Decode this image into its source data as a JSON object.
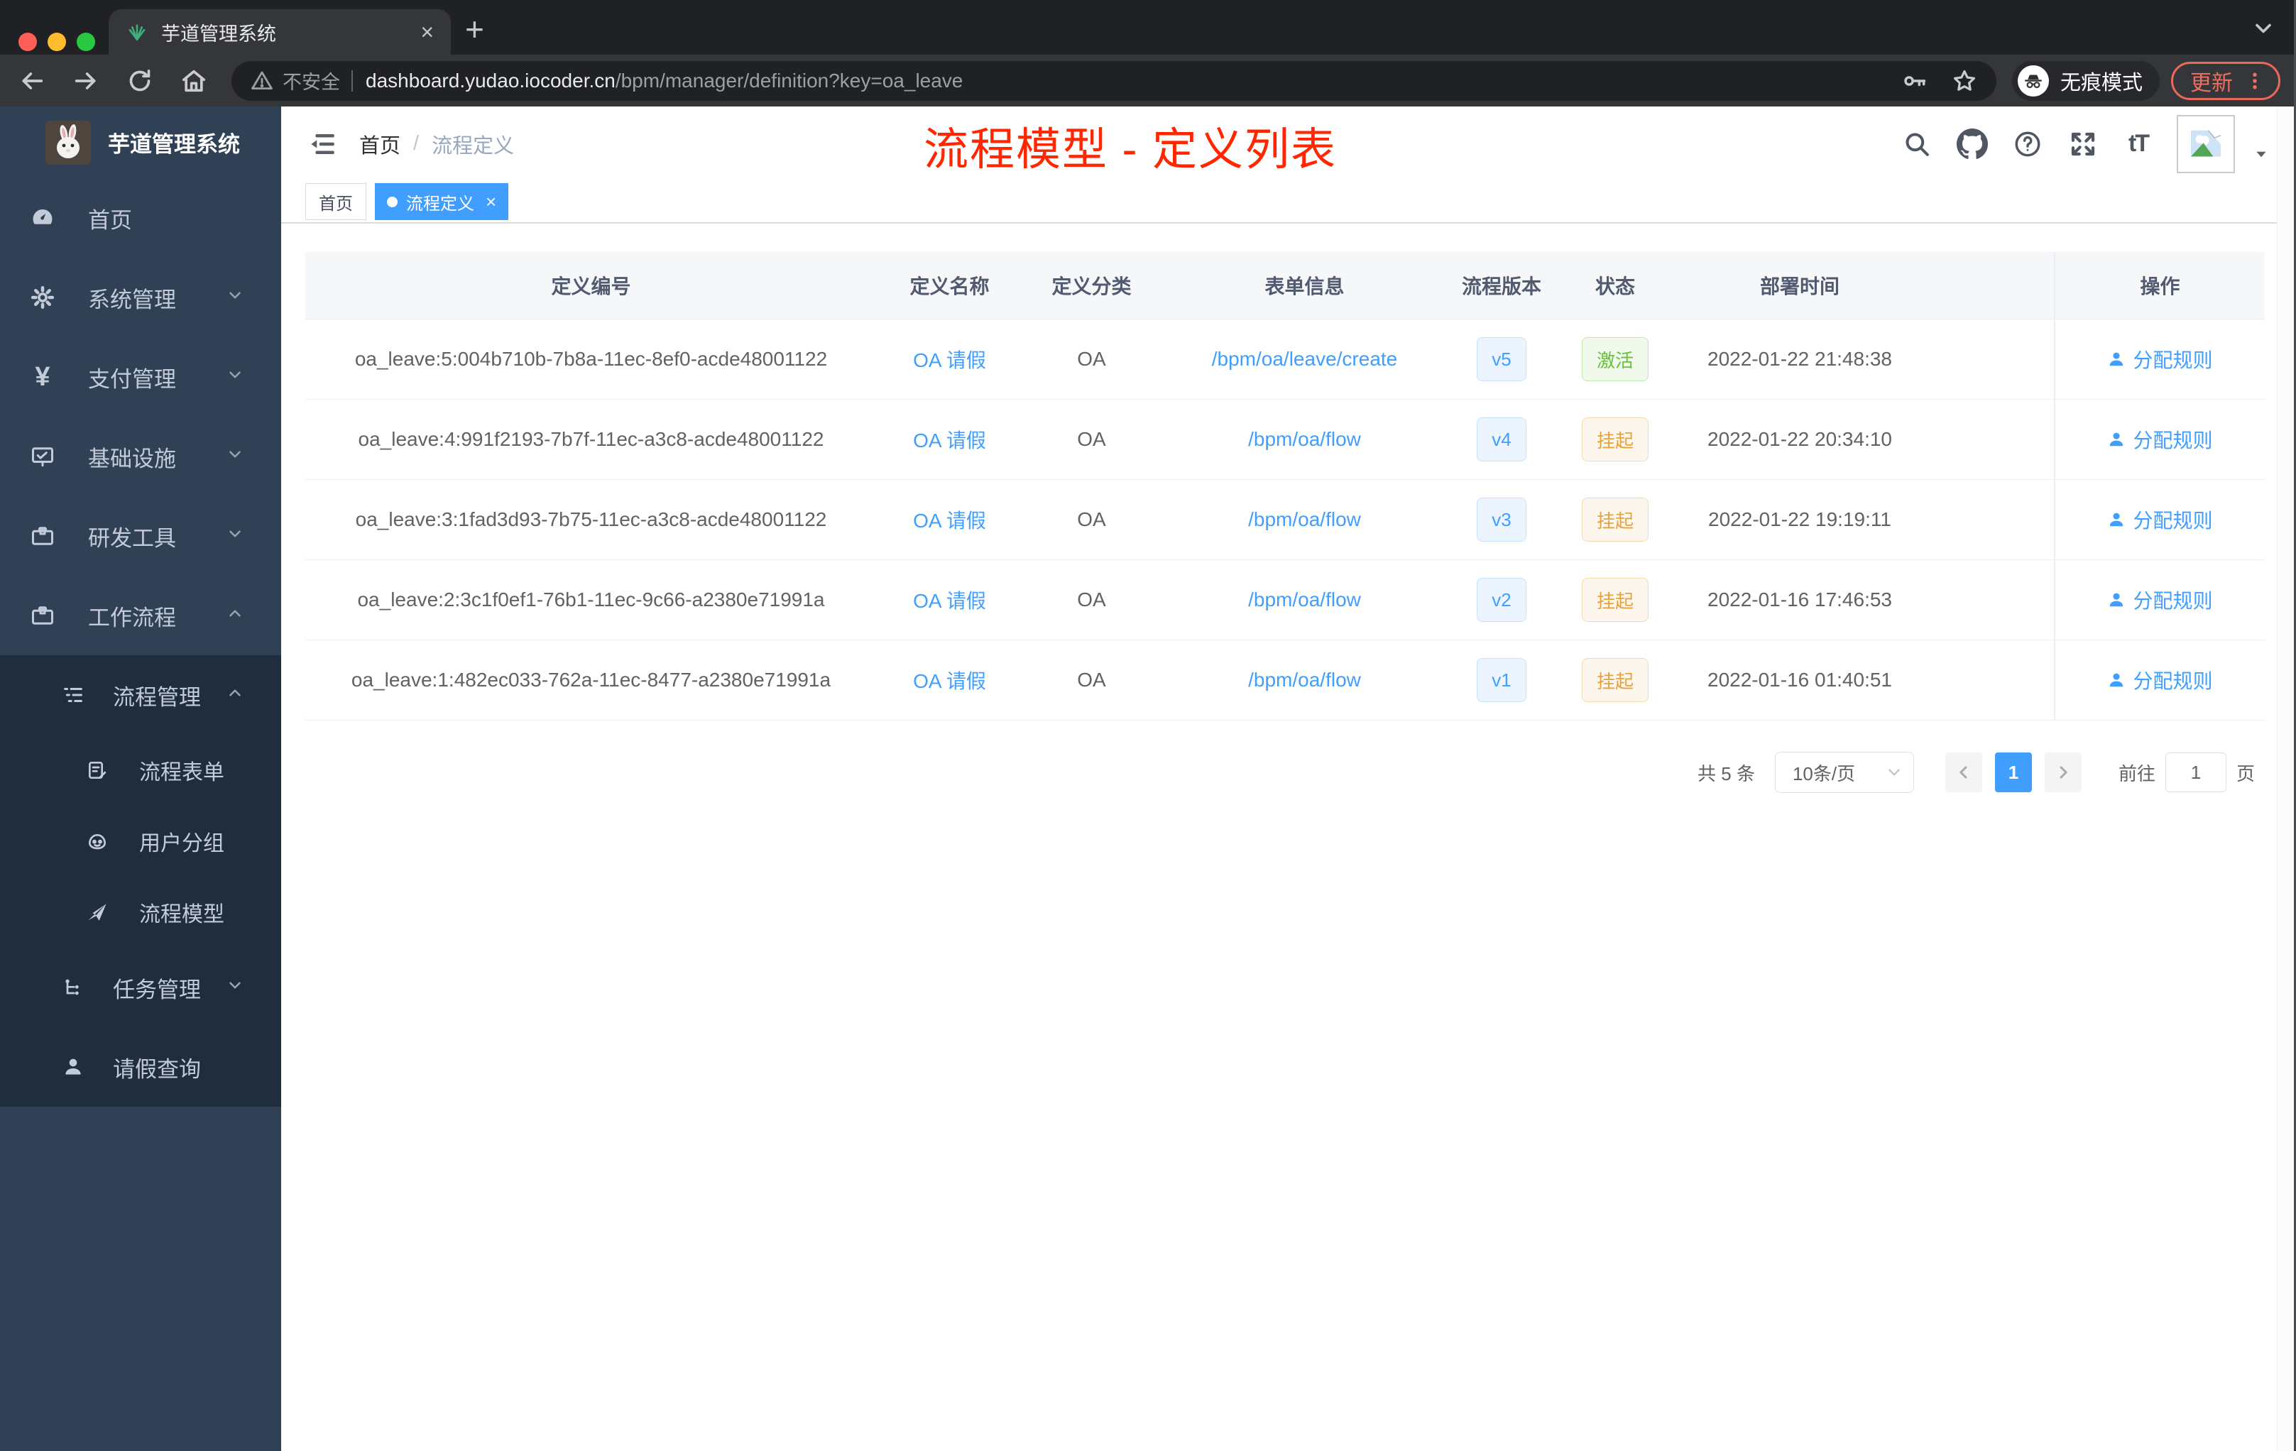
{
  "browser": {
    "tab_title": "芋道管理系统",
    "new_tab_label": "+",
    "close_tab_label": "×",
    "security_label": "不安全",
    "url_domain": "dashboard.yudao.iocoder.cn",
    "url_path": "/bpm/manager/definition?key=oa_leave",
    "incognito_label": "无痕模式",
    "update_label": "更新"
  },
  "sidebar": {
    "title": "芋道管理系统",
    "menu": [
      {
        "label": "首页"
      },
      {
        "label": "系统管理"
      },
      {
        "label": "支付管理"
      },
      {
        "label": "基础设施"
      },
      {
        "label": "研发工具"
      },
      {
        "label": "工作流程"
      }
    ],
    "yen_glyph": "¥",
    "workflow_submenu": {
      "process_management": {
        "label": "流程管理"
      },
      "process_form": {
        "label": "流程表单"
      },
      "user_group": {
        "label": "用户分组"
      },
      "process_model": {
        "label": "流程模型"
      },
      "task_management": {
        "label": "任务管理"
      },
      "leave_query": {
        "label": "请假查询"
      }
    }
  },
  "header": {
    "breadcrumb": {
      "home": "首页",
      "separator": "/",
      "current": "流程定义"
    },
    "annotation": "流程模型 - 定义列表",
    "font_size_icon_label": "tT"
  },
  "tags": {
    "home": "首页",
    "active": "流程定义",
    "close": "×"
  },
  "table": {
    "columns": [
      "定义编号",
      "定义名称",
      "定义分类",
      "表单信息",
      "流程版本",
      "状态",
      "部署时间",
      "操作"
    ],
    "rows": [
      {
        "id": "oa_leave:5:004b710b-7b8a-11ec-8ef0-acde48001122",
        "name": "OA 请假",
        "category": "OA",
        "form": "/bpm/oa/leave/create",
        "version": "v5",
        "status": "激活",
        "status_type": "success",
        "deploy_time": "2022-01-22 21:48:38",
        "action": "分配规则"
      },
      {
        "id": "oa_leave:4:991f2193-7b7f-11ec-a3c8-acde48001122",
        "name": "OA 请假",
        "category": "OA",
        "form": "/bpm/oa/flow",
        "version": "v4",
        "status": "挂起",
        "status_type": "warning",
        "deploy_time": "2022-01-22 20:34:10",
        "action": "分配规则"
      },
      {
        "id": "oa_leave:3:1fad3d93-7b75-11ec-a3c8-acde48001122",
        "name": "OA 请假",
        "category": "OA",
        "form": "/bpm/oa/flow",
        "version": "v3",
        "status": "挂起",
        "status_type": "warning",
        "deploy_time": "2022-01-22 19:19:11",
        "action": "分配规则"
      },
      {
        "id": "oa_leave:2:3c1f0ef1-76b1-11ec-9c66-a2380e71991a",
        "name": "OA 请假",
        "category": "OA",
        "form": "/bpm/oa/flow",
        "version": "v2",
        "status": "挂起",
        "status_type": "warning",
        "deploy_time": "2022-01-16 17:46:53",
        "action": "分配规则"
      },
      {
        "id": "oa_leave:1:482ec033-762a-11ec-8477-a2380e71991a",
        "name": "OA 请假",
        "category": "OA",
        "form": "/bpm/oa/flow",
        "version": "v1",
        "status": "挂起",
        "status_type": "warning",
        "deploy_time": "2022-01-16 01:40:51",
        "action": "分配规则"
      }
    ]
  },
  "pagination": {
    "total": "共 5 条",
    "page_size": "10条/页",
    "current_page": "1",
    "goto_label": "前往",
    "goto_value": "1",
    "page_label": "页"
  },
  "colors": {
    "accent": "#409eff",
    "success": "#67c23a",
    "warning": "#e6a23c",
    "annotation_red": "#ff2600",
    "sidebar_bg": "#304156",
    "submenu_bg": "#1f2d3d",
    "tab_active": "#409eff"
  }
}
